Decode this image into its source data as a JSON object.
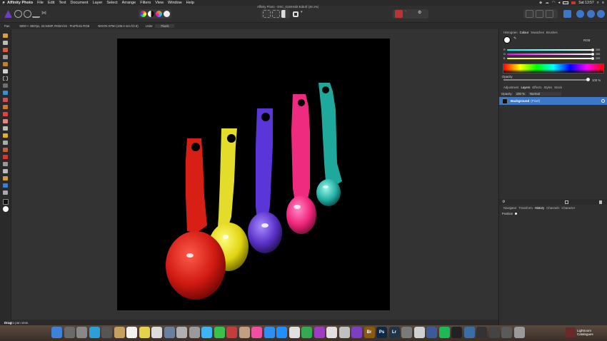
{
  "menubar": {
    "apple": "",
    "items": [
      "Affinity Photo",
      "File",
      "Edit",
      "Text",
      "Document",
      "Layer",
      "Select",
      "Arrange",
      "Filters",
      "View",
      "Window",
      "Help"
    ],
    "clock": "Sat 13:57"
  },
  "window": {
    "title": "Affinity Photo - DSC_0138-Edit-Edit.tif (46.1%)"
  },
  "context": {
    "tool": "Pan",
    "doc_info": "5000 × 4987px, 24.94MP, RGBA/16 - ProPhoto RGB",
    "camera": "NIKON D750 (105.0 mm f/2.8)",
    "units_label": "Units:",
    "units_value": "Pixels"
  },
  "panel": {
    "top_tabs": [
      "Histogram",
      "Colour",
      "Swatches",
      "Brushes"
    ],
    "color_mode": "RGB",
    "rgb_values": [
      "255",
      "255",
      "255"
    ],
    "opacity_label": "Opacity",
    "opacity_value": "100 %",
    "mid_tabs": [
      "Adjustment",
      "Layers",
      "Effects",
      "Styles",
      "Stock"
    ],
    "layer_opacity_label": "Opacity:",
    "layer_opacity_value": "100 %",
    "blend_mode": "Normal",
    "layer_name": "Background",
    "layer_type": "(Pixel)",
    "bottom_tabs": [
      "Navigator",
      "Transform",
      "History",
      "Channels",
      "Character"
    ],
    "history_item": "Position"
  },
  "status": {
    "bold": "Drag",
    "rest": " to pan view."
  },
  "dock": {
    "catalogues_line1": "Lightroom",
    "catalogues_line2": "Catalogues",
    "icons": [
      {
        "name": "finder-icon",
        "color": "#3b82d8",
        "glyph": ""
      },
      {
        "name": "launchpad-icon",
        "color": "#6a6a6a",
        "glyph": ""
      },
      {
        "name": "system-preferences-icon",
        "color": "#888888",
        "glyph": ""
      },
      {
        "name": "safari-icon",
        "color": "#2a9fd8",
        "glyph": ""
      },
      {
        "name": "compass-icon",
        "color": "#555555",
        "glyph": ""
      },
      {
        "name": "notes-icon",
        "color": "#c6a060",
        "glyph": ""
      },
      {
        "name": "calendar-icon",
        "color": "#f2f2f2",
        "glyph": ""
      },
      {
        "name": "stickies-icon",
        "color": "#e6d14a",
        "glyph": ""
      },
      {
        "name": "preview-icon",
        "color": "#dcdcdc",
        "glyph": ""
      },
      {
        "name": "photos-app-icon",
        "color": "#6a7fa0",
        "glyph": ""
      },
      {
        "name": "disk-utility-icon",
        "color": "#b0b0b0",
        "glyph": ""
      },
      {
        "name": "migration-icon",
        "color": "#9a9a9a",
        "glyph": ""
      },
      {
        "name": "messages-icon",
        "color": "#3fb4f2",
        "glyph": ""
      },
      {
        "name": "facetime-icon",
        "color": "#3cc04c",
        "glyph": ""
      },
      {
        "name": "photo-booth-icon",
        "color": "#c43c3c",
        "glyph": ""
      },
      {
        "name": "contacts-icon",
        "color": "#c0a080",
        "glyph": ""
      },
      {
        "name": "itunes-icon",
        "color": "#f050a0",
        "glyph": ""
      },
      {
        "name": "app-store-icon",
        "color": "#2f8ff0",
        "glyph": ""
      },
      {
        "name": "safari-2-icon",
        "color": "#1e90ff",
        "glyph": ""
      },
      {
        "name": "chrome-icon",
        "color": "#e0e0e0",
        "glyph": ""
      },
      {
        "name": "numbers-icon",
        "color": "#35a853",
        "glyph": ""
      },
      {
        "name": "affinity-designer-icon",
        "color": "#9c3cc0",
        "glyph": ""
      },
      {
        "name": "color-picker-icon",
        "color": "#e0e0e0",
        "glyph": ""
      },
      {
        "name": "lightroom-photo-icon",
        "color": "#c0c0c0",
        "glyph": ""
      },
      {
        "name": "affinity-photo-icon",
        "color": "#7b3fbf",
        "glyph": ""
      },
      {
        "name": "bridge-icon",
        "color": "#8a5a10",
        "glyph": "Br"
      },
      {
        "name": "photoshop-icon",
        "color": "#0c2a48",
        "glyph": "Ps"
      },
      {
        "name": "lightroom-icon",
        "color": "#1e3448",
        "glyph": "Lr"
      },
      {
        "name": "utility-icon",
        "color": "#7a7a7a",
        "glyph": ""
      },
      {
        "name": "image-app-icon",
        "color": "#d0d0d0",
        "glyph": ""
      },
      {
        "name": "music-app-icon",
        "color": "#3a5a9a",
        "glyph": ""
      },
      {
        "name": "spotify-icon",
        "color": "#1db954",
        "glyph": ""
      },
      {
        "name": "terminal-icon",
        "color": "#222222",
        "glyph": ""
      },
      {
        "name": "scanner-icon",
        "color": "#3a6ea5",
        "glyph": ""
      },
      {
        "name": "camera-icon",
        "color": "#333333",
        "glyph": ""
      },
      {
        "name": "photo-viewer-icon",
        "color": "#444444",
        "glyph": ""
      },
      {
        "name": "clipboard-icon",
        "color": "#5a5a5a",
        "glyph": ""
      },
      {
        "name": "trash-icon",
        "color": "#9a9a9a",
        "glyph": ""
      }
    ]
  }
}
